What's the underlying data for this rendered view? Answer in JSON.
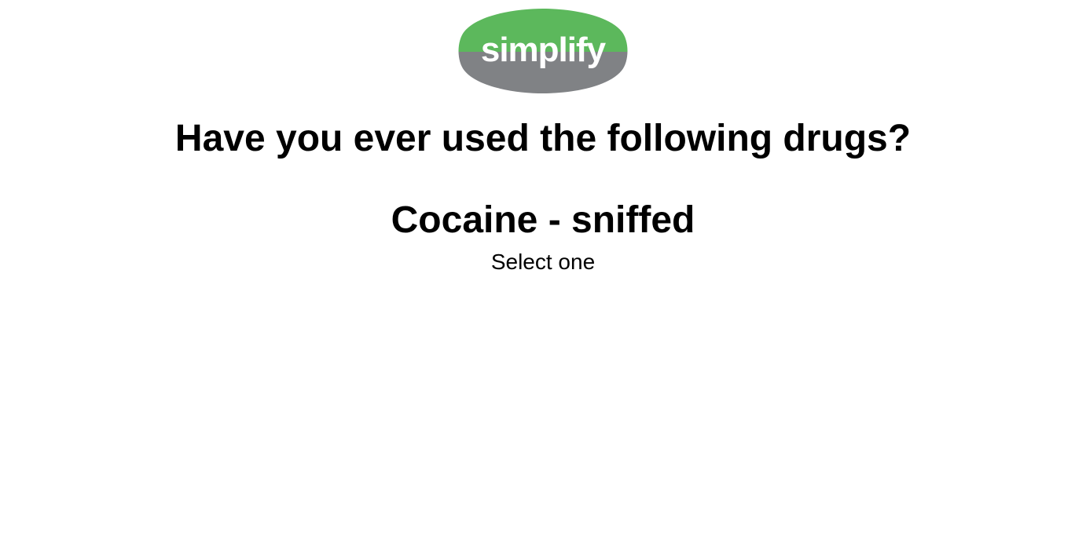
{
  "logo": {
    "text": "simplify",
    "colors": {
      "top": "#5cb85c",
      "bottom": "#808285",
      "text": "#ffffff"
    }
  },
  "question": {
    "title": "Have you ever used the following drugs?",
    "item": "Cocaine - sniffed",
    "instruction": "Select one"
  }
}
